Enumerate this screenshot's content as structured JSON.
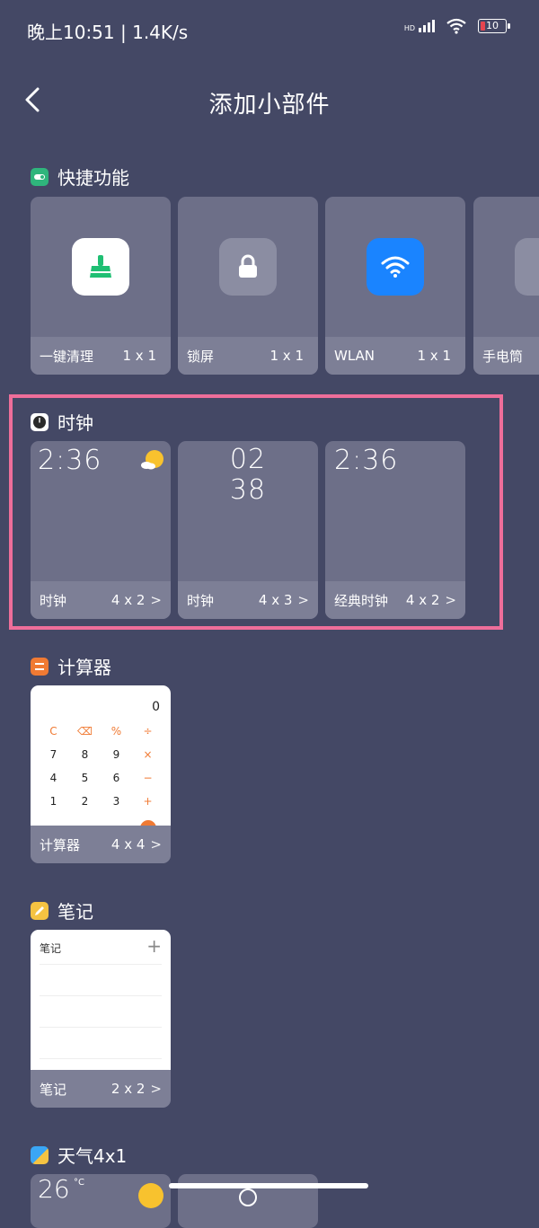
{
  "status": {
    "time": "晚上10:51 | 1.4K/s",
    "battery": "10",
    "hd": "HD"
  },
  "header": {
    "title": "添加小部件"
  },
  "sections": {
    "quick": {
      "title": "快捷功能",
      "items": [
        {
          "name": "一键清理",
          "size": "1 x 1"
        },
        {
          "name": "锁屏",
          "size": "1 x 1"
        },
        {
          "name": "WLAN",
          "size": "1 x 1"
        },
        {
          "name": "手电筒",
          "size": ""
        }
      ]
    },
    "clock": {
      "title": "时钟",
      "items": [
        {
          "name": "时钟",
          "size": "4 x 2",
          "time": "2:36"
        },
        {
          "name": "时钟",
          "size": "4 x 3",
          "hour": "02",
          "minute": "38"
        },
        {
          "name": "经典时钟",
          "size": "4 x 2",
          "time": "2:36"
        }
      ]
    },
    "calculator": {
      "title": "计算器",
      "items": [
        {
          "name": "计算器",
          "size": "4 x 4"
        }
      ],
      "display": "0",
      "keys": [
        "C",
        "⌫",
        "%",
        "÷",
        "7",
        "8",
        "9",
        "×",
        "4",
        "5",
        "6",
        "−",
        "1",
        "2",
        "3",
        "+"
      ]
    },
    "notes": {
      "title": "笔记",
      "items": [
        {
          "name": "笔记",
          "size": "2 x 2"
        }
      ],
      "widget_label": "笔记"
    },
    "weather": {
      "title": "天气4x1",
      "temp": "26",
      "unit": "°C"
    }
  },
  "chevron": ">",
  "colors": {
    "background": "#444865",
    "highlight": "#ee6e9a",
    "clean_green": "#1fbf73",
    "wlan_blue": "#1a84ff",
    "calc_orange": "#f07a33",
    "note_yellow": "#f5c342",
    "quick_teal": "#2fb57c"
  }
}
